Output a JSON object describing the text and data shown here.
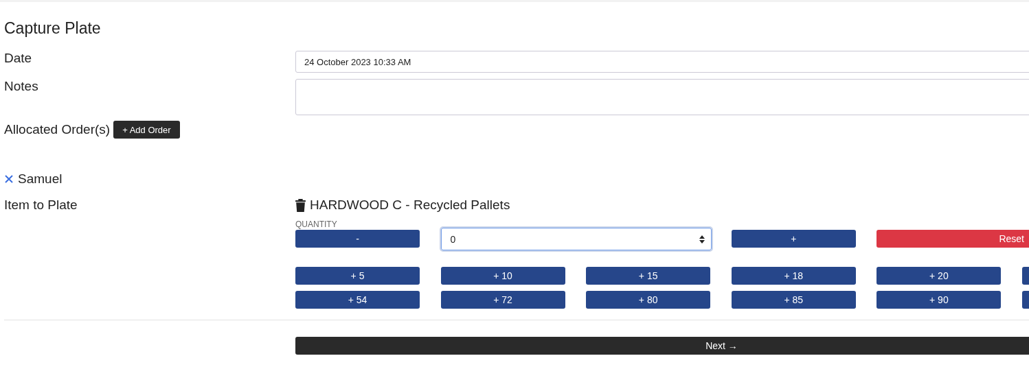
{
  "title": "Capture Plate",
  "date": {
    "label": "Date",
    "value": "24 October 2023 10:33 AM"
  },
  "notes": {
    "label": "Notes"
  },
  "allocated": {
    "label": "Allocated Order(s)",
    "button": "+ Add Order"
  },
  "order": {
    "name": "Samuel"
  },
  "item": {
    "label": "Item to Plate",
    "name": "HARDWOOD C - Recycled Pallets"
  },
  "quantity": {
    "label": "QUANTITY",
    "minus": "-",
    "value": "0",
    "plus": "+",
    "reset": "Reset"
  },
  "quick_add": [
    [
      {
        "label": "+ 5"
      },
      {
        "label": "+ 10"
      },
      {
        "label": "+ 15"
      },
      {
        "label": "+ 18"
      },
      {
        "label": "+ 20"
      }
    ],
    [
      {
        "label": "+ 54"
      },
      {
        "label": "+ 72"
      },
      {
        "label": "+ 80"
      },
      {
        "label": "+ 85"
      },
      {
        "label": "+ 90"
      }
    ]
  ],
  "next": "Next →"
}
